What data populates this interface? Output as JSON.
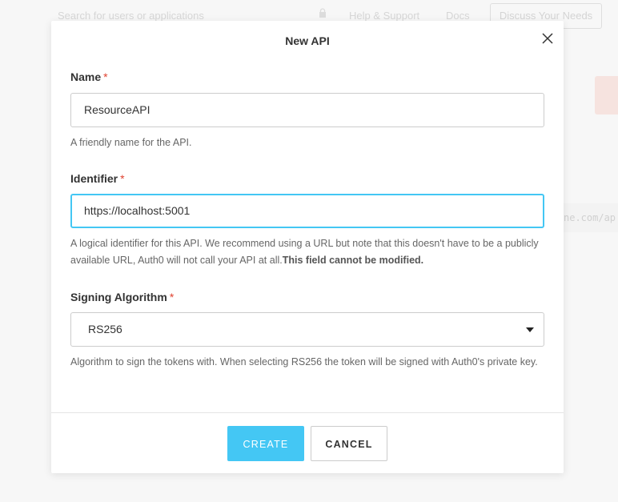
{
  "background": {
    "search_placeholder": "Search for users or applications",
    "help_label": "Help & Support",
    "docs_label": "Docs",
    "discuss_label": "Discuss Your Needs",
    "url_hint": "ne.com/ap"
  },
  "modal": {
    "title": "New API",
    "name": {
      "label": "Name",
      "required": "*",
      "value": "ResourceAPI",
      "help": "A friendly name for the API."
    },
    "identifier": {
      "label": "Identifier",
      "required": "*",
      "value": "https://localhost:5001",
      "help": "A logical identifier for this API. We recommend using a URL but note that this doesn't have to be a publicly available URL, Auth0 will not call your API at all.",
      "help_bold": "This field cannot be modified."
    },
    "signing": {
      "label": "Signing Algorithm",
      "required": "*",
      "value": "RS256",
      "help": "Algorithm to sign the tokens with. When selecting RS256 the token will be signed with Auth0's private key."
    },
    "create_label": "CREATE",
    "cancel_label": "CANCEL"
  },
  "colors": {
    "accent": "#44c7f4",
    "required": "#e0412f"
  },
  "icons": {
    "close": "close-icon",
    "caret": "caret-down-icon",
    "lock": "lock-icon"
  }
}
